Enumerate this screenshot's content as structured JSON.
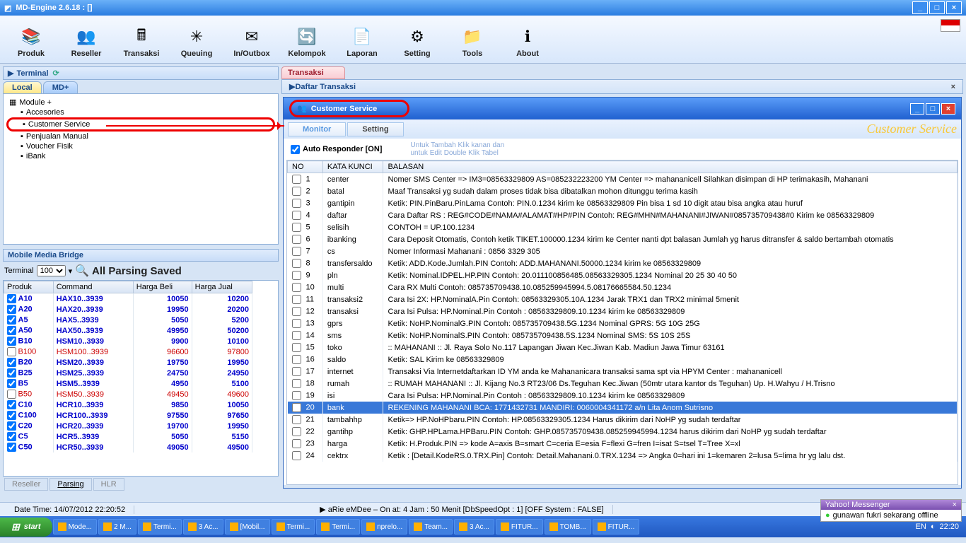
{
  "title": "MD-Engine 2.6.18 : []",
  "toolbar": [
    {
      "label": "Produk",
      "icon": "books"
    },
    {
      "label": "Reseller",
      "icon": "people"
    },
    {
      "label": "Transaksi",
      "icon": "calc"
    },
    {
      "label": "Queuing",
      "icon": "gear"
    },
    {
      "label": "In/Outbox",
      "icon": "mail"
    },
    {
      "label": "Kelompok",
      "icon": "group"
    },
    {
      "label": "Laporan",
      "icon": "report"
    },
    {
      "label": "Setting",
      "icon": "wrench"
    },
    {
      "label": "Tools",
      "icon": "folder"
    },
    {
      "label": "About",
      "icon": "about"
    }
  ],
  "terminal_label": "Terminal",
  "tabs": {
    "local": "Local",
    "mdplus": "MD+"
  },
  "tree": {
    "root": "Module +",
    "items": [
      "Accesories",
      "Customer Service",
      "Penjualan Manual",
      "Voucher Fisik",
      "iBank"
    ]
  },
  "bridge": {
    "title": "Mobile Media Bridge",
    "terminal_label": "Terminal",
    "terminal_value": "100",
    "parse_label": "All Parsing Saved"
  },
  "price_headers": [
    "Produk",
    "Command",
    "Harga Beli",
    "Harga Jual"
  ],
  "price_rows": [
    {
      "chk": true,
      "c": "blue",
      "p": "A10",
      "cmd": "HAX10.<tujuan>.3939",
      "hb": "10050",
      "hj": "10200"
    },
    {
      "chk": true,
      "c": "blue",
      "p": "A20",
      "cmd": "HAX20.<tujuan>.3939",
      "hb": "19950",
      "hj": "20200"
    },
    {
      "chk": true,
      "c": "blue",
      "p": "A5",
      "cmd": "HAX5.<tujuan>.3939",
      "hb": "5050",
      "hj": "5200"
    },
    {
      "chk": true,
      "c": "blue",
      "p": "A50",
      "cmd": "HAX50.<tujuan>.3939",
      "hb": "49950",
      "hj": "50200"
    },
    {
      "chk": true,
      "c": "blue",
      "p": "B10",
      "cmd": "HSM10.<tujuan>.3939",
      "hb": "9900",
      "hj": "10100"
    },
    {
      "chk": false,
      "c": "red",
      "p": "B100",
      "cmd": "HSM100.<tujuan>.3939",
      "hb": "96600",
      "hj": "97800"
    },
    {
      "chk": true,
      "c": "blue",
      "p": "B20",
      "cmd": "HSM20.<tujuan>.3939",
      "hb": "19750",
      "hj": "19950"
    },
    {
      "chk": true,
      "c": "blue",
      "p": "B25",
      "cmd": "HSM25.<tujuan>.3939",
      "hb": "24750",
      "hj": "24950"
    },
    {
      "chk": true,
      "c": "blue",
      "p": "B5",
      "cmd": "HSM5.<tujuan>.3939",
      "hb": "4950",
      "hj": "5100"
    },
    {
      "chk": false,
      "c": "red",
      "p": "B50",
      "cmd": "HSM50.<tujuan>.3939",
      "hb": "49450",
      "hj": "49600"
    },
    {
      "chk": true,
      "c": "blue",
      "p": "C10",
      "cmd": "HCR10.<tujuan>.3939",
      "hb": "9850",
      "hj": "10050"
    },
    {
      "chk": true,
      "c": "blue",
      "p": "C100",
      "cmd": "HCR100.<tujuan>.3939",
      "hb": "97550",
      "hj": "97650"
    },
    {
      "chk": true,
      "c": "blue",
      "p": "C20",
      "cmd": "HCR20.<tujuan>.3939",
      "hb": "19700",
      "hj": "19950"
    },
    {
      "chk": true,
      "c": "blue",
      "p": "C5",
      "cmd": "HCR5.<tujuan>.3939",
      "hb": "5050",
      "hj": "5150"
    },
    {
      "chk": true,
      "c": "blue",
      "p": "C50",
      "cmd": "HCR50.<tujuan>.3939",
      "hb": "49050",
      "hj": "49500"
    }
  ],
  "bottom_tabs": [
    "Reseller",
    "Parsing",
    "HLR"
  ],
  "right": {
    "tab": "Transaksi",
    "daftar": "Daftar Transaksi",
    "cs_title": "Customer Service",
    "cs_tabs": {
      "monitor": "Monitor",
      "setting": "Setting"
    },
    "cs_right": "Customer Service",
    "auto_label": "Auto Responder [ON]",
    "hint": "Untuk Tambah Klik kanan dan\nuntuk Edit Double Klik Tabel",
    "headers": [
      "NO",
      "KATA KUNCI",
      "BALASAN"
    ],
    "rows": [
      {
        "no": 1,
        "kk": "center",
        "b": "Nomer SMS Center => IM3=08563329809 AS=085232223200 YM Center => mahananicell Silahkan disimpan di HP terimakasih, Mahanani"
      },
      {
        "no": 2,
        "kk": "batal",
        "b": "Maaf Transaksi yg sudah dalam proses tidak bisa dibatalkan mohon ditunggu terima kasih"
      },
      {
        "no": 3,
        "kk": "gantipin",
        "b": "Ketik: PIN.PinBaru.PinLama Contoh: PIN.0.1234 kirim ke 08563329809 Pin bisa 1 sd 10 digit atau bisa angka atau huruf"
      },
      {
        "no": 4,
        "kk": "daftar",
        "b": "Cara Daftar RS : REG#CODE#NAMA#ALAMAT#HP#PIN Contoh: REG#MHN#MAHANANI#JIWAN#085735709438#0 Kirim ke 08563329809"
      },
      {
        "no": 5,
        "kk": "selisih",
        "b": "CONTOH = UP.100.1234"
      },
      {
        "no": 6,
        "kk": "ibanking",
        "b": "Cara Deposit Otomatis, Contoh ketik TIKET.100000.1234 kirim ke Center nanti dpt balasan Jumlah yg harus ditransfer & saldo bertambah otomatis"
      },
      {
        "no": 7,
        "kk": "cs",
        "b": "Nomer Informasi Mahanani : 0856 3329 305"
      },
      {
        "no": 8,
        "kk": "transfersaldo",
        "b": "Ketik: ADD.Kode.Jumlah.PIN Contoh: ADD.MAHANANI.50000.1234 kirim ke 08563329809"
      },
      {
        "no": 9,
        "kk": "pln",
        "b": "Ketik: Nominal.IDPEL.HP.PIN Contoh: 20.011100856485.08563329305.1234 Nominal 20 25 30 40 50"
      },
      {
        "no": 10,
        "kk": "multi",
        "b": "Cara RX Multi Contoh: 085735709438.10.085259945994.5.08176665584.50.1234"
      },
      {
        "no": 11,
        "kk": "transaksi2",
        "b": "Cara Isi 2X: HP.NominalA.Pin Contoh: 08563329305.10A.1234 Jarak TRX1 dan TRX2 minimal 5menit"
      },
      {
        "no": 12,
        "kk": "transaksi",
        "b": "Cara Isi Pulsa: HP.Nominal.Pin Contoh : 08563329809.10.1234 kirim ke 08563329809"
      },
      {
        "no": 13,
        "kk": "gprs",
        "b": "Ketik: NoHP.NominalG.PIN Contoh: 085735709438.5G.1234 Nominal GPRS: 5G 10G 25G"
      },
      {
        "no": 14,
        "kk": "sms",
        "b": "Ketik: NoHP.NominalS.PIN Contoh: 085735709438.5S.1234 Nominal SMS: 5S 10S 25S"
      },
      {
        "no": 15,
        "kk": "toko",
        "b": ":: MAHANANI :: Jl. Raya Solo No.117 Lapangan Jiwan Kec.Jiwan Kab. Madiun Jawa Timur 63161"
      },
      {
        "no": 16,
        "kk": "saldo",
        "b": "Ketik: SAL Kirim ke 08563329809"
      },
      {
        "no": 17,
        "kk": "internet",
        "b": "Transaksi Via Internetdaftarkan ID YM anda ke Mahananicara transaksi sama spt via HPYM Center : mahananicell"
      },
      {
        "no": 18,
        "kk": "rumah",
        "b": ":: RUMAH MAHANANI :: Jl. Kijang No.3 RT23/06 Ds.Teguhan Kec.Jiwan (50mtr utara kantor ds Teguhan) Up. H.Wahyu / H.Trisno"
      },
      {
        "no": 19,
        "kk": "isi",
        "b": "Cara Isi Pulsa: HP.Nominal.Pin Contoh : 08563329809.10.1234 kirim ke 08563329809"
      },
      {
        "no": 20,
        "kk": "bank",
        "b": "REKENING MAHANANI BCA: 1771432731 MANDIRI: 0060004341172 a/n Lita Anom Sutrisno",
        "sel": true
      },
      {
        "no": 21,
        "kk": "tambahhp",
        "b": "Ketik=> HP.NoHPbaru.PIN Contoh: HP.08563329305.1234 Harus dikirim dari NoHP yg sudah terdaftar"
      },
      {
        "no": 22,
        "kk": "gantihp",
        "b": "Ketik: GHP.HPLama.HPBaru.PIN Contoh: GHP.085735709438.085259945994.1234 harus dikirim dari NoHP yg sudah terdaftar"
      },
      {
        "no": 23,
        "kk": "harga",
        "b": "Ketik: H.Produk.PIN => kode A=axis B=smart C=ceria E=esia F=flexi G=fren I=isat S=tsel T=Tree X=xl"
      },
      {
        "no": 24,
        "kk": "cektrx",
        "b": "Ketik : [Detail.KodeRS.0.TRX.Pin] Contoh: Detail.Mahanani.0.TRX.1234 => Angka 0=hari ini 1=kemaren 2=lusa 5=lima hr yg lalu dst."
      }
    ]
  },
  "status": {
    "datetime": "Date Time: 14/07/2012 22:20:52",
    "right": "aRie eMDee – On at: 4 Jam : 50 Menit  [DbSpeedOpt : 1] [OFF System : FALSE]"
  },
  "ym": {
    "title": "Yahoo! Messenger",
    "msg": "gunawan fukri sekarang offline"
  },
  "taskbar": {
    "start": "start",
    "items": [
      "Mode...",
      "2 M...",
      "Termi...",
      "3 Ac...",
      "[Mobil...",
      "Termi...",
      "Termi...",
      "nprelo...",
      "Team...",
      "3 Ac...",
      "FITUR...",
      "TOMB...",
      "FITUR..."
    ],
    "lang": "EN",
    "time": "22:20"
  }
}
